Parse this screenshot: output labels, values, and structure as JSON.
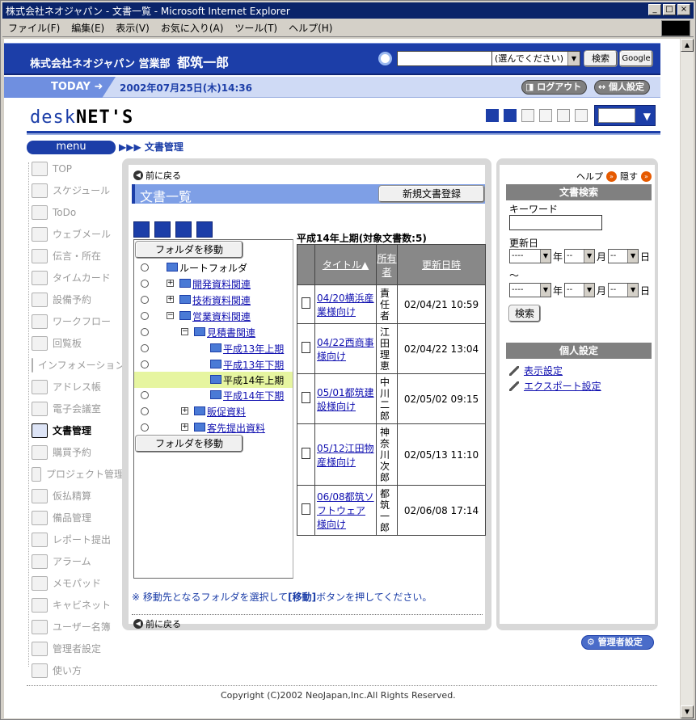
{
  "window": {
    "title": "株式会社ネオジャパン - 文書一覧 - Microsoft Internet Explorer",
    "buttons": [
      "_",
      "□",
      "×"
    ]
  },
  "menubar": [
    "ファイル(F)",
    "編集(E)",
    "表示(V)",
    "お気に入り(A)",
    "ツール(T)",
    "ヘルプ(H)"
  ],
  "header": {
    "company": "株式会社ネオジャパン 営業部",
    "user": "都筑一郎",
    "search_select": "(選んでください)",
    "search_button": "検索",
    "google_button": "Google",
    "accent_color": "#1c3ea8"
  },
  "todaybar": {
    "today_label": "TODAY",
    "date": "2002年07月25日(木)14:36",
    "logout": "ログアウト",
    "settings": "個人設定"
  },
  "logo": {
    "part1": "desk",
    "part2": "NET'S"
  },
  "menu_label": "menu",
  "breadcrumb": "▶▶▶ 文書管理",
  "nav": [
    {
      "label": "TOP",
      "icon": "home-icon"
    },
    {
      "label": "スケジュール",
      "icon": "calendar-icon"
    },
    {
      "label": "ToDo",
      "icon": "todo-icon"
    },
    {
      "label": "ウェブメール",
      "icon": "mail-icon"
    },
    {
      "label": "伝言・所在",
      "icon": "person-icon"
    },
    {
      "label": "タイムカード",
      "icon": "clock-icon"
    },
    {
      "label": "設備予約",
      "icon": "facility-icon"
    },
    {
      "label": "ワークフロー",
      "icon": "workflow-icon"
    },
    {
      "label": "回覧板",
      "icon": "board-icon"
    },
    {
      "label": "インフォメーション",
      "icon": "info-icon"
    },
    {
      "label": "アドレス帳",
      "icon": "address-book-icon"
    },
    {
      "label": "電子会議室",
      "icon": "conference-icon"
    },
    {
      "label": "文書管理",
      "icon": "document-icon"
    },
    {
      "label": "購買予約",
      "icon": "cart-icon"
    },
    {
      "label": "プロジェクト管理",
      "icon": "project-icon"
    },
    {
      "label": "仮払精算",
      "icon": "payment-icon"
    },
    {
      "label": "備品管理",
      "icon": "equipment-icon"
    },
    {
      "label": "レポート提出",
      "icon": "report-icon"
    },
    {
      "label": "アラーム",
      "icon": "alarm-icon"
    },
    {
      "label": "メモパッド",
      "icon": "memo-icon"
    },
    {
      "label": "キャビネット",
      "icon": "cabinet-icon"
    },
    {
      "label": "ユーザー名簿",
      "icon": "user-list-icon"
    },
    {
      "label": "管理者設定",
      "icon": "admin-icon"
    },
    {
      "label": "使い方",
      "icon": "help-icon"
    }
  ],
  "main": {
    "back_label": "前に戻る",
    "title": "文書一覧",
    "new_doc_button": "新規文書登録",
    "move_button": "フォルダを移動",
    "tree": [
      {
        "label": "ルートフォルダ",
        "link": false
      },
      {
        "label": "開発資料関連",
        "link": true,
        "exp": "⊞"
      },
      {
        "label": "技術資料関連",
        "link": true,
        "exp": "⊞"
      },
      {
        "label": "営業資料関連",
        "link": true,
        "exp": "⊟"
      },
      {
        "label": "見積書関連",
        "link": true,
        "exp": "⊟"
      },
      {
        "label": "平成13年上期",
        "link": true
      },
      {
        "label": "平成13年下期",
        "link": true
      },
      {
        "label": "平成14年上期",
        "link": true
      },
      {
        "label": "平成14年下期",
        "link": true
      },
      {
        "label": "販促資料",
        "link": true,
        "exp": "⊞"
      },
      {
        "label": "客先提出資料",
        "link": true,
        "exp": "⊞"
      }
    ],
    "docs_heading": "平成14年上期(対象文書数:5)",
    "table_headers": {
      "title": "タイトル▲",
      "owner": "所有者",
      "updated": "更新日時"
    },
    "docs": [
      {
        "title": "04/20横浜産業様向け",
        "owner": "責任者",
        "updated": "02/04/21 10:59"
      },
      {
        "title": "04/22西商事様向け",
        "owner": "江田理恵",
        "updated": "02/04/22 13:04"
      },
      {
        "title": "05/01都筑建設様向け",
        "owner": "中川二郎",
        "updated": "02/05/02 09:15"
      },
      {
        "title": "05/12江田物産様向け",
        "owner": "神奈川次郎",
        "updated": "02/05/13 11:10"
      },
      {
        "title": "06/08都筑ソフトウェア様向け",
        "owner": "都筑一郎",
        "updated": "02/06/08 17:14"
      }
    ],
    "note_pre": "※ 移動先となるフォルダを選択して",
    "note_bold": "[移動]",
    "note_post": "ボタンを押してください。"
  },
  "right": {
    "help": "ヘルプ",
    "hide": "隠す",
    "search_title": "文書検索",
    "keyword_label": "キーワード",
    "updated_label": "更新日",
    "year_unit": "年",
    "month_unit": "月",
    "day_unit": "日",
    "year_default": "----",
    "md_default": "--",
    "tilde": "～",
    "search_button": "検索",
    "personal_title": "個人設定",
    "display_settings": "表示設定",
    "export_settings": "エクスポート設定"
  },
  "admin_button": "管理者設定",
  "copyright": "Copyright (C)2002 NeoJapan,Inc.All Rights Reserved."
}
